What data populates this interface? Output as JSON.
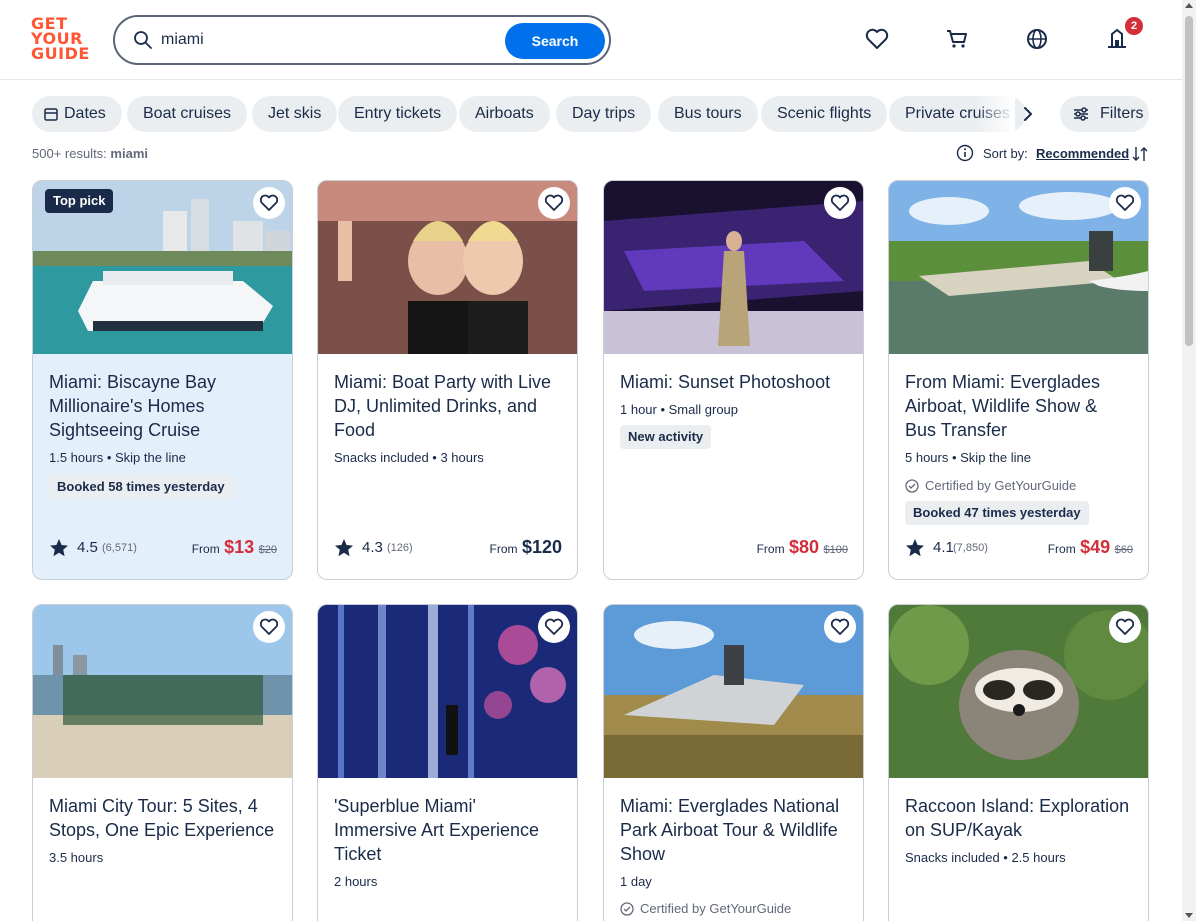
{
  "header": {
    "logo_lines": [
      "GET",
      "YOUR",
      "GUIDE"
    ],
    "search_value": "miami",
    "search_button": "Search",
    "cart_badge": "2"
  },
  "chips": [
    "Dates",
    "Boat cruises",
    "Jet skis",
    "Entry tickets",
    "Airboats",
    "Day trips",
    "Bus tours",
    "Scenic flights",
    "Private cruises"
  ],
  "filters_label": "Filters",
  "results": {
    "count": "500+ results:",
    "query": "miami",
    "sort_label": "Sort by:",
    "sort_value": "Recommended"
  },
  "colors": {
    "brand": "#ff5533",
    "accent": "#0071eb",
    "sale": "#d32f3a",
    "text": "#1a2b49"
  },
  "cards": [
    {
      "badge": "Top pick",
      "title": "Miami: Biscayne Bay Millionaire's Homes Sightseeing Cruise",
      "meta": "1.5 hours • Skip the line",
      "pill": "Booked 58 times yesterday",
      "rating": "4.5",
      "reviews": "(6,571)",
      "from": "From",
      "price": "$13",
      "old_price": "$20"
    },
    {
      "title": "Miami: Boat Party with Live DJ, Unlimited Drinks, and Food",
      "meta": "Snacks included • 3 hours",
      "rating": "4.3",
      "reviews": "(126)",
      "from": "From",
      "price": "$120"
    },
    {
      "title": "Miami: Sunset Photoshoot",
      "meta": "1 hour • Small group",
      "pill": "New activity",
      "from": "From",
      "price": "$80",
      "old_price": "$100"
    },
    {
      "title": "From Miami: Everglades Airboat, Wildlife Show & Bus Transfer",
      "meta": "5 hours • Skip the line",
      "certified": "Certified by GetYourGuide",
      "pill": "Booked 47 times yesterday",
      "rating": "4.1",
      "reviews": "(7,850)",
      "from": "From",
      "price": "$49",
      "old_price": "$60"
    },
    {
      "title": "Miami City Tour: 5 Sites, 4 Stops, One Epic Experience",
      "meta": "3.5 hours"
    },
    {
      "title": "'Superblue Miami' Immersive Art Experience Ticket",
      "meta": "2 hours"
    },
    {
      "title": "Miami: Everglades National Park Airboat Tour & Wildlife Show",
      "meta": "1 day",
      "certified": "Certified by GetYourGuide"
    },
    {
      "title": "Raccoon Island: Exploration on SUP/Kayak",
      "meta": "Snacks included • 2.5 hours"
    }
  ]
}
